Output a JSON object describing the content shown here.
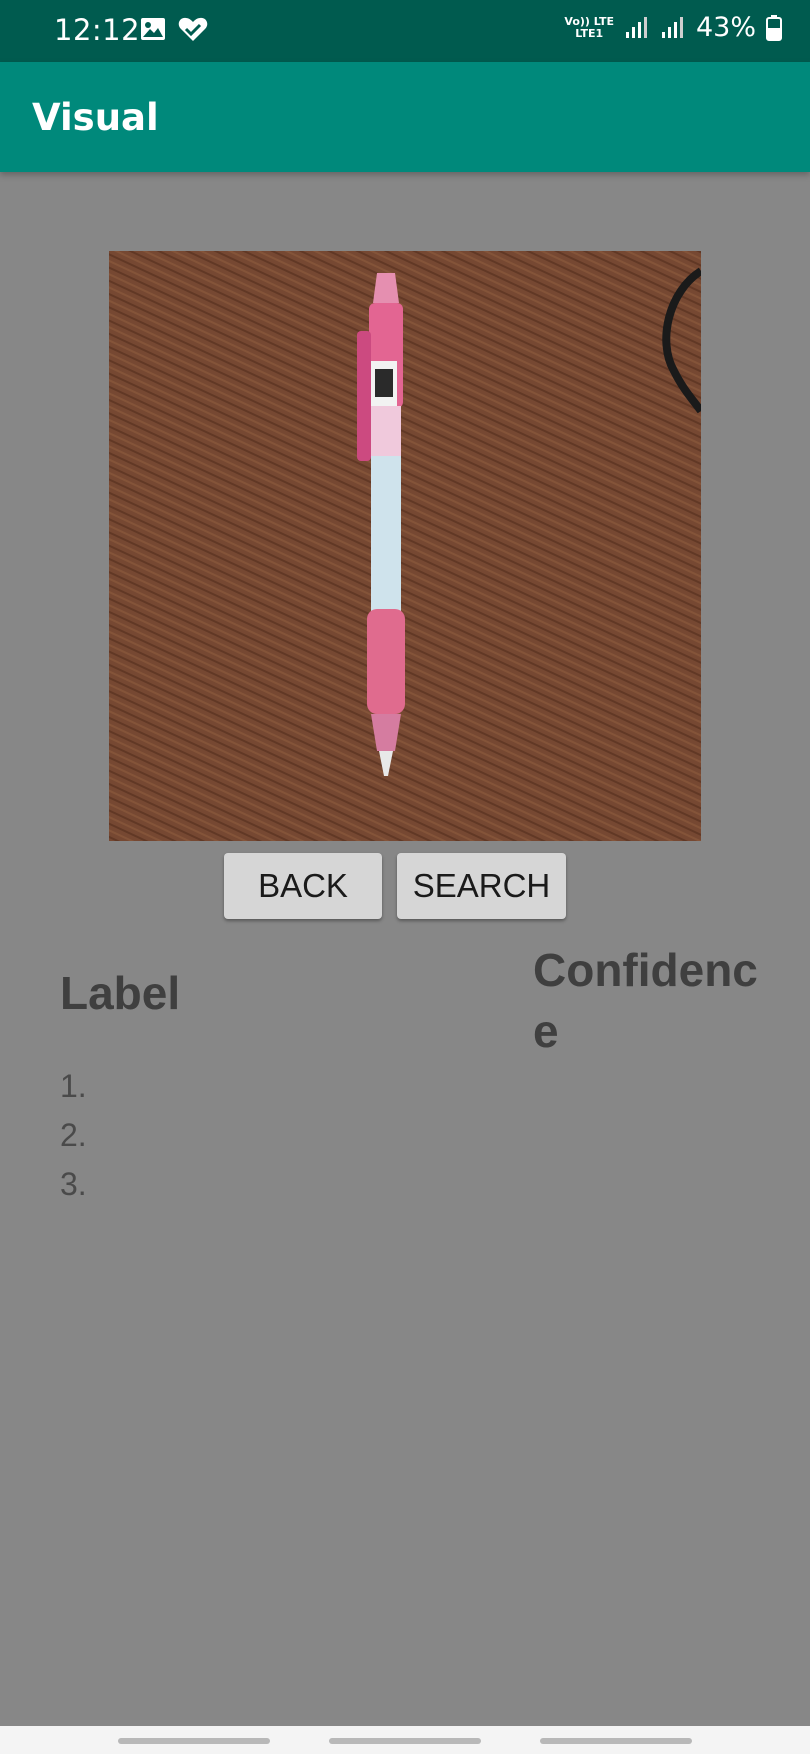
{
  "status_bar": {
    "time": "12:12",
    "icons_left": [
      "gallery-icon",
      "health-icon"
    ],
    "network_label_top": "Vo)) LTE",
    "network_label_bottom": "LTE1",
    "battery": "43%",
    "colors": {
      "background": "#005b4f",
      "text": "#ffffff"
    }
  },
  "app_bar": {
    "title": "Visual",
    "color": "#00897b"
  },
  "image": {
    "description_icon": "pen-photo"
  },
  "buttons": {
    "back_label": "BACK",
    "search_label": "SEARCH"
  },
  "results": {
    "label_heading": "Label",
    "confidence_heading": "Confidence",
    "items": [
      "1.",
      "2.",
      "3."
    ]
  },
  "colors": {
    "screen_background": "#878787",
    "heading_text": "#3f3f3f"
  }
}
